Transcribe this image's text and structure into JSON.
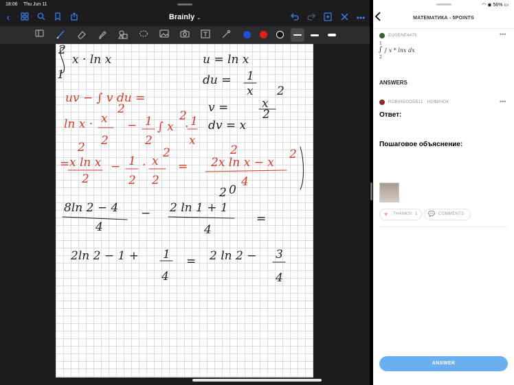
{
  "status": {
    "time": "18:06",
    "date": "Thu Jun 11",
    "battery": "56%"
  },
  "app": {
    "title": "Brainly"
  },
  "icons": {
    "back": "chevron-left-icon",
    "grid": "grid-icon",
    "search": "search-icon",
    "bookmark": "bookmark-icon",
    "share": "share-icon",
    "undo": "undo-icon",
    "redo": "redo-icon",
    "add_page": "add-page-icon",
    "close": "close-icon",
    "more": "more-icon"
  },
  "colors": {
    "accent": "#3a82f7",
    "pen_blue": "#1e4fd8",
    "pen_red": "#e0201c",
    "pen_black": "#111111",
    "ink_red": "#d33a2c",
    "answer_button": "#6ab0f0"
  },
  "note": {
    "black_lines": [
      "∫ x·ln x",
      "u = ln x",
      "du = 1/x",
      "v = x²/2",
      "dv = x"
    ],
    "red_lines": [
      "uv − ∫ v du =",
      "ln x · x²/2 − 1/2 ∫ x²·1/x",
      "= x² ln x / 2 − 1/2 · x²/2 = (2x² ln x − x²)/4"
    ],
    "result_lines": [
      "(8 ln 2 − 4)/4 − (2 ln 1 + 1)/4 =",
      "2 ln 2 − 1 + 1/4 = 2 ln 2 − 3/4"
    ]
  },
  "brainly": {
    "subject": "МАТЕМАТИКА - 5POINTS",
    "asker": "EUGENE4475",
    "question": "∫ x * lnx dx",
    "question_limits": {
      "upper": "1",
      "lower": "2"
    },
    "answers_heading": "ANSWERS",
    "answerer": "ROBINGOOD511 · НОВИЧОК",
    "answer_label": "Ответ:",
    "explanation_label": "Пошаговое объяснение:",
    "thanks_label": "THANKS!",
    "thanks_count": "1",
    "comments_label": "COMMENTS",
    "answer_button": "ANSWER"
  }
}
